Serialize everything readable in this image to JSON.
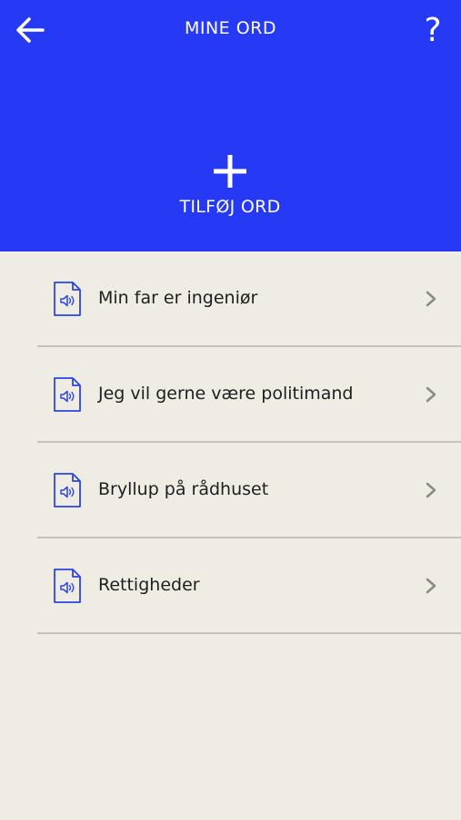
{
  "header": {
    "title": "MINE ORD",
    "help_label": "?",
    "add_label": "TILFØJ ORD",
    "background_color": "#2639f4"
  },
  "icons": {
    "back": "arrow-left-icon",
    "add": "plus-icon",
    "item": "audio-file-icon",
    "chevron": "chevron-right-icon"
  },
  "items": [
    {
      "label": "Min far er ingeniør"
    },
    {
      "label": "Jeg vil gerne være politimand"
    },
    {
      "label": "Bryllup på rådhuset"
    },
    {
      "label": "Rettigheder"
    }
  ]
}
